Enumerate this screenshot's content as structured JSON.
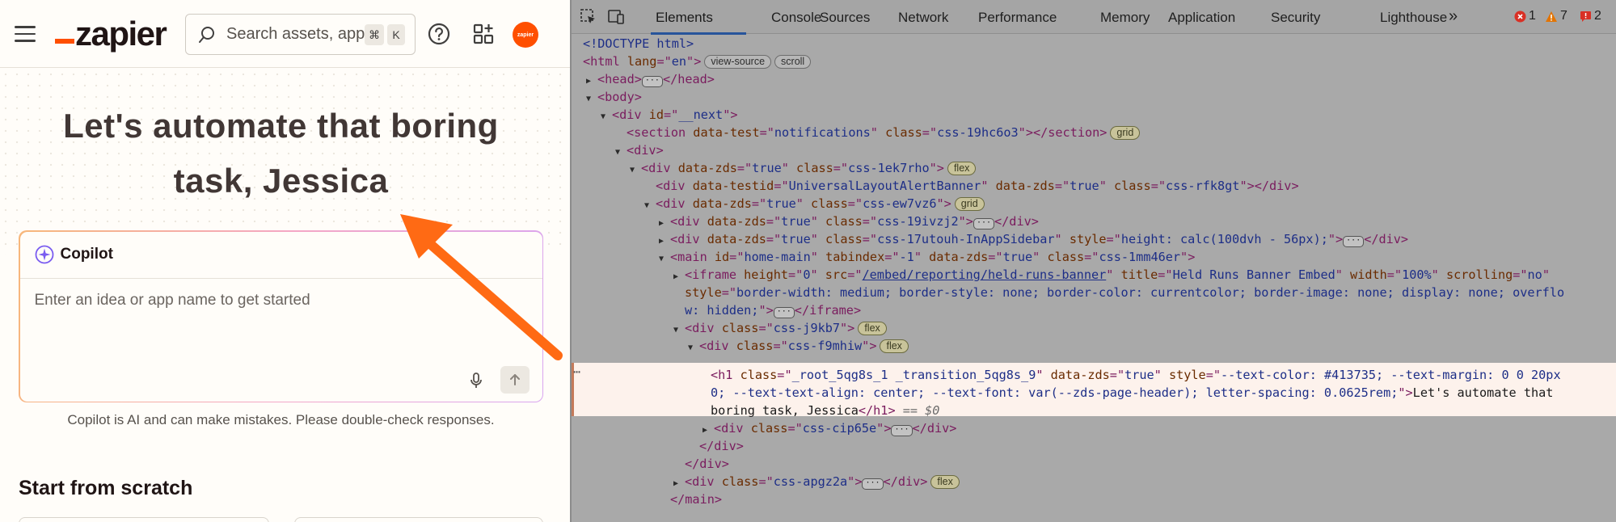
{
  "app": {
    "logo_text": "zapier",
    "search": {
      "placeholder": "Search assets, apps",
      "shortcut_cmd": "⌘",
      "shortcut_key": "K"
    },
    "avatar_text": "zapier",
    "hero_title": "Let's automate that boring task, Jessica",
    "copilot": {
      "label": "Copilot",
      "placeholder": "Enter an idea or app name to get started"
    },
    "disclaimer": "Copilot is AI and can make mistakes. Please double-check responses.",
    "section_title": "Start from scratch",
    "colors": {
      "brand": "#ff4f00",
      "text": "#413735",
      "arrow": "#ff6a14"
    }
  },
  "devtools": {
    "tabs": [
      "Elements",
      "Console",
      "Sources",
      "Network",
      "Performance",
      "Memory",
      "Application",
      "Security",
      "Lighthouse"
    ],
    "active_tab": "Elements",
    "more_tabs": "»",
    "counters": {
      "errors": "1",
      "warnings": "7",
      "issues": "2"
    },
    "lines": {
      "l0": "<!DOCTYPE html>",
      "l1a": "<html ",
      "l1b": "lang",
      "l1c": "=\"",
      "l1d": "en",
      "l1e": "\">",
      "l1_b1": "view-source",
      "l1_b2": "scroll",
      "l2": "<head>",
      "l2b": "</head>",
      "l3": "<body>",
      "l4a": "<div ",
      "l4b": "id",
      "l4c": "__next",
      "l5a": "<section ",
      "l5b": "data-test",
      "l5c": "notifications",
      "l5d": "class",
      "l5e": "css-19hc6o3",
      "l5f": "></section>",
      "l5_b": "grid",
      "l6": "<div>",
      "l7a": "<div ",
      "l7b": "data-zds",
      "l7c": "true",
      "l7d": "class",
      "l7e": "css-1ek7rho",
      "l7_b": "flex",
      "l8a": "<div ",
      "l8b": "data-testid",
      "l8c": "UniversalLayoutAlertBanner",
      "l8d": "data-zds",
      "l8e": "true",
      "l8f": "class",
      "l8g": "css-rfk8gt",
      "l8h": "></div>",
      "l9a": "<div ",
      "l9b": "data-zds",
      "l9c": "true",
      "l9d": "class",
      "l9e": "css-ew7vz6",
      "l9_b": "grid",
      "l10a": "<div ",
      "l10b": "data-zds",
      "l10c": "true",
      "l10d": "class",
      "l10e": "css-19ivzj2",
      "l10f": "</div>",
      "l11a": "<div ",
      "l11b": "data-zds",
      "l11c": "true",
      "l11d": "class",
      "l11e": "css-17utouh-InAppSidebar",
      "l11f": "style",
      "l11g": "height: calc(100dvh - 56px);",
      "l11h": "</div>",
      "l12a": "<main ",
      "l12b": "id",
      "l12c": "home-main",
      "l12d": "tabindex",
      "l12e": "-1",
      "l12f": "data-zds",
      "l12g": "true",
      "l12h": "class",
      "l12i": "css-1mm46er",
      "l13a": "<iframe ",
      "l13b": "height",
      "l13c": "0",
      "l13d": "src",
      "l13e": "/embed/reporting/held-runs-banner",
      "l13f": "title",
      "l13g": "Held Runs Banner Embed",
      "l13h": "width",
      "l13i": "100%",
      "l13j": "scrolling",
      "l13k": "no",
      "l14a": "style",
      "l14b": "border-width: medium; border-style: none; border-color: currentcolor; border-image: none; display: none; overflo",
      "l15a": "w: hidden;",
      "l15b": "</iframe>",
      "l16a": "<div ",
      "l16b": "class",
      "l16c": "css-j9kb7",
      "l16_b": "flex",
      "l17a": "<div ",
      "l17b": "class",
      "l17c": "css-f9mhiw",
      "l17_b": "flex",
      "sel1a": "<h1 ",
      "sel1b": "class",
      "sel1c": "_root_5qg8s_1 _transition_5qg8s_9",
      "sel1d": "data-zds",
      "sel1e": "true",
      "sel1f": "style",
      "sel1g": "--text-color: #413735; --text-margin: 0 0 20px",
      "sel2a": "0; --text-text-align: center; --text-font: var(--zds-page-header); letter-spacing: 0.0625rem;",
      "sel2b": ">",
      "sel2c": "Let's automate that",
      "sel3a": "boring task, Jessica",
      "sel3b": "</h1>",
      "sel3c": " == $0",
      "l19a": "<div ",
      "l19b": "class",
      "l19c": "css-cip65e",
      "l19d": "</div>",
      "l20": "</div>",
      "l21": "</div>",
      "l22a": "<div ",
      "l22b": "class",
      "l22c": "css-apgz2a",
      "l22d": "</div>",
      "l22_b": "flex",
      "l23": "</main>"
    }
  }
}
